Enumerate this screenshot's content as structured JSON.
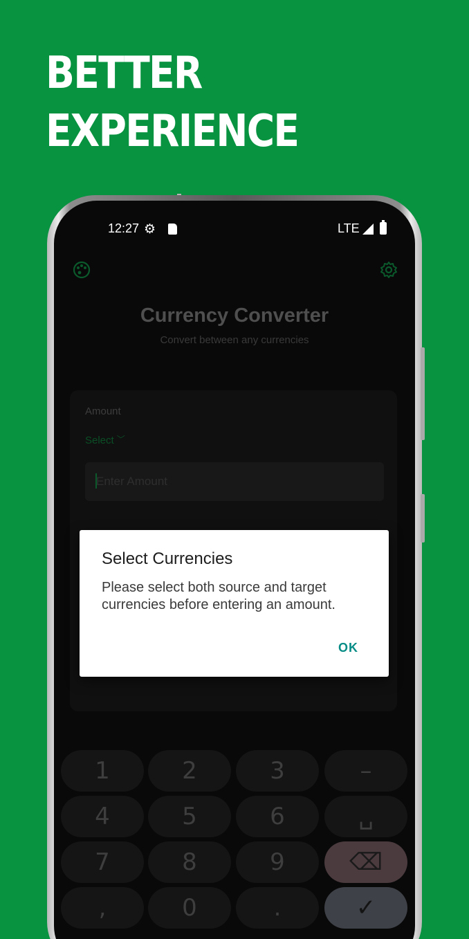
{
  "headline": {
    "line1": "BETTER",
    "line2": "EXPERIENCE"
  },
  "status_bar": {
    "time": "12:27",
    "network": "LTE",
    "icons": [
      "settings-gear-icon",
      "sd-card-icon",
      "signal-icon",
      "battery-icon"
    ]
  },
  "app": {
    "palette_icon": "palette-icon",
    "settings_icon": "settings-icon",
    "title": "Currency Converter",
    "subtitle": "Convert between any currencies",
    "amount_label": "Amount",
    "select_label": "Select",
    "amount_placeholder": "Enter Amount"
  },
  "keypad": {
    "rows": [
      [
        "1",
        "2",
        "3",
        "–"
      ],
      [
        "4",
        "5",
        "6",
        "␣"
      ],
      [
        "7",
        "8",
        "9",
        "⌫"
      ],
      [
        ",",
        "0",
        ".",
        "✓"
      ]
    ]
  },
  "dialog": {
    "title": "Select Currencies",
    "message": "Please select both source and target currencies before entering an amount.",
    "ok_label": "OK"
  },
  "colors": {
    "background": "#079340",
    "accent": "#078c86",
    "dim_green": "#0b5a2c"
  }
}
